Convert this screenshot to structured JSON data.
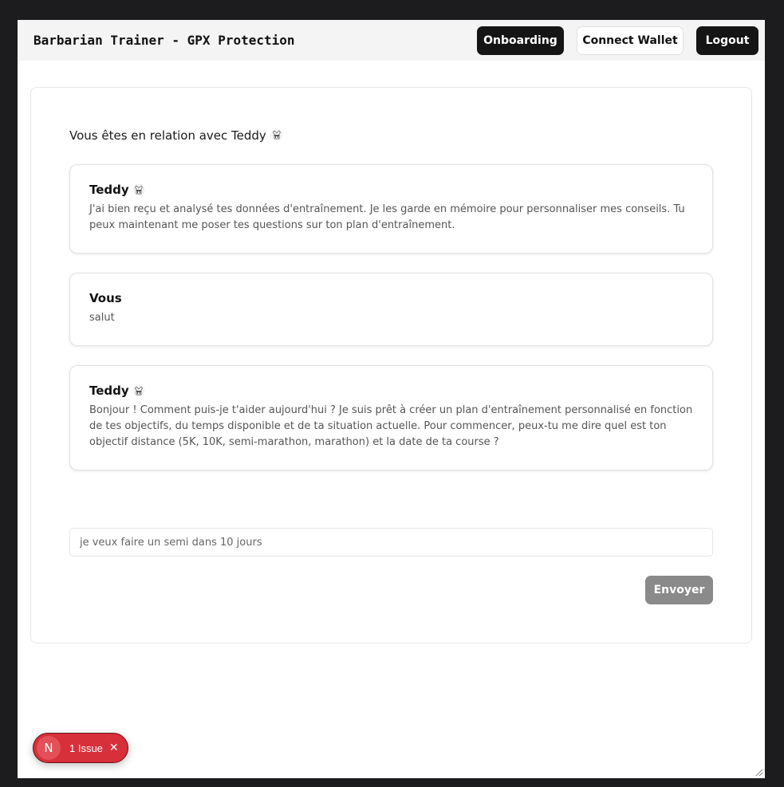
{
  "header": {
    "app_title": "Barbarian Trainer - GPX Protection",
    "onboarding_label": "Onboarding",
    "connect_wallet_label": "Connect Wallet",
    "logout_label": "Logout"
  },
  "chat": {
    "relation_text": "Vous êtes en relation avec Teddy",
    "coach_icon": "martial-arts-uniform-icon",
    "messages": [
      {
        "author": "Teddy",
        "has_icon": true,
        "text": "J'ai bien reçu et analysé tes données d'entraînement. Je les garde en mémoire pour personnaliser mes conseils. Tu peux maintenant me poser tes questions sur ton plan d'entraînement."
      },
      {
        "author": "Vous",
        "has_icon": false,
        "text": "salut"
      },
      {
        "author": "Teddy",
        "has_icon": true,
        "text": "Bonjour ! Comment puis-je t'aider aujourd'hui ? Je suis prêt à créer un plan d'entraînement personnalisé en fonction de tes objectifs, du temps disponible et de ta situation actuelle. Pour commencer, peux-tu me dire quel est ton objectif distance (5K, 10K, semi-marathon, marathon) et la date de ta course ?"
      }
    ],
    "input_value": "je veux faire un semi dans 10 jours",
    "send_label": "Envoyer"
  },
  "devtools": {
    "logo_letter": "N",
    "issue_label": "1 Issue",
    "close_glyph": "✕"
  },
  "colors": {
    "dark_button": "#151515",
    "send_button": "#8a8a8a",
    "issue_pill": "#d7303a"
  }
}
